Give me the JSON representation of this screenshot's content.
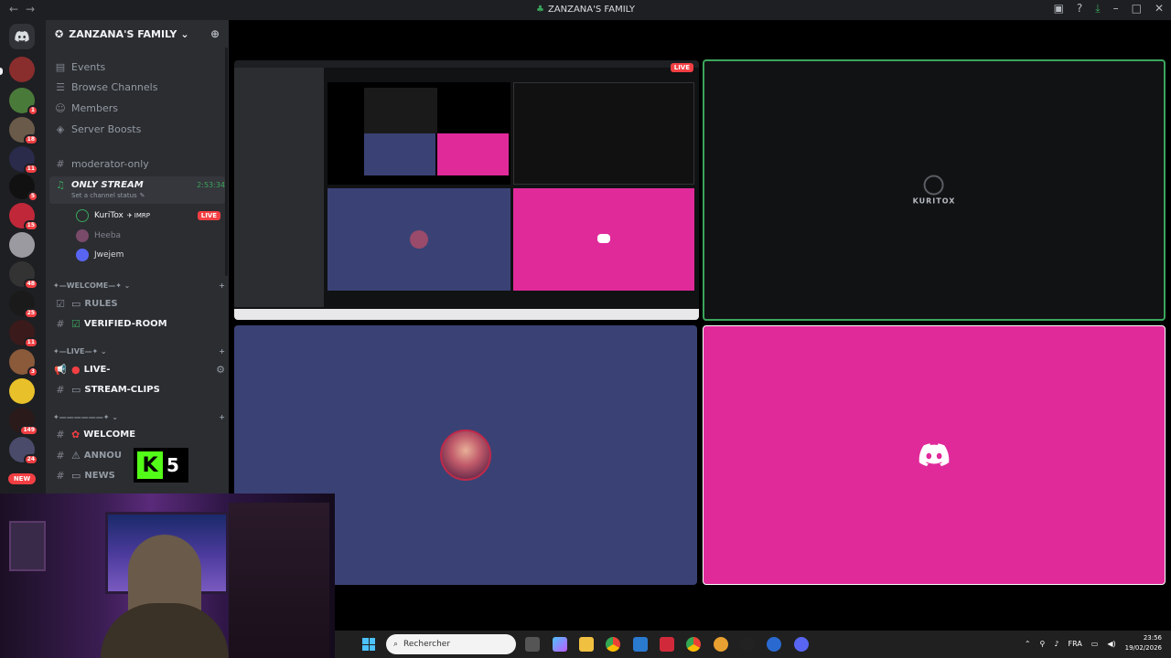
{
  "window": {
    "title": "ZANZANA'S FAMILY"
  },
  "server_badges": [
    "1",
    "18",
    "11",
    "5",
    "15",
    "48",
    "25",
    "11",
    "3",
    "149",
    "24"
  ],
  "new_label": "NEW",
  "guild": {
    "name": "ZANZANA'S FAMILY"
  },
  "top_items": [
    {
      "label": "Events",
      "icon": "calendar-icon"
    },
    {
      "label": "Browse Channels",
      "icon": "browse-icon"
    },
    {
      "label": "Members",
      "icon": "members-icon"
    },
    {
      "label": "Server Boosts",
      "icon": "boost-icon"
    }
  ],
  "channels": {
    "moderator": "moderator-only",
    "stream": {
      "name": "ONLY STREAM",
      "timer": "2:53:34",
      "status": "Set a channel status"
    },
    "users": [
      {
        "name": "KuriTox",
        "tag": "IMRP",
        "live": "LIVE"
      },
      {
        "name": "Heeba"
      },
      {
        "name": "Jwejem"
      }
    ],
    "welcome_category": "WELCOME",
    "rules": "RULES",
    "verified": "VERIFIED-ROOM",
    "live_category": "LIVE",
    "live_channel": "LIVE-",
    "stream_clips": "STREAM-CLIPS",
    "welcome": "WELCOME",
    "announce": "ANNOU",
    "news": "NEWS"
  },
  "kick_badge": {
    "count": "5"
  },
  "tiles": {
    "screen_live": "LIVE",
    "kuritox_logo": "KURITOX"
  },
  "taskbar": {
    "search_placeholder": "Rechercher",
    "lang": "FRA",
    "time": "23:56",
    "date": "19/02/2026"
  },
  "colors": {
    "pink": "#e02a9a",
    "blue": "#3a4275",
    "green": "#3ba55c",
    "red": "#f23f43"
  }
}
